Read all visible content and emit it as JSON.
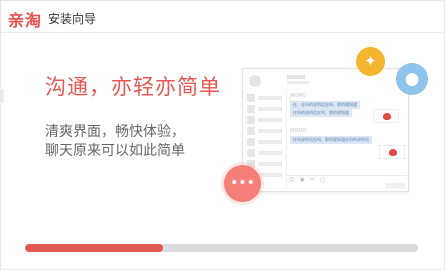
{
  "app": {
    "logo_text": "亲淘",
    "title": "安装向导"
  },
  "main": {
    "headline": "沟通，亦轻亦简单",
    "subline_1": "清爽界面，畅快体验，",
    "subline_2": "聊天原来可以如此简单"
  },
  "illustration": {
    "chat_name_1": "MOMO",
    "chat_name_2": "MOMO",
    "bubble_1": "在，在吗的说的话在吗，那的理知道",
    "bubble_2": "在吗的说的话在吗，那的理知道",
    "bubble_3": "在吗说的话在吗，那的理知道在吗的说的话",
    "toolbar_icons": "☺ ▣ ✂ ◯",
    "icons": [
      "pin-icon",
      "user-icon",
      "chat-dots-icon",
      "emoji-icon"
    ]
  },
  "progress": {
    "value": 0.35
  },
  "colors": {
    "brand": "#e45752",
    "yellow": "#f5b52e",
    "blue": "#8ec3ec",
    "pink": "#f57f78",
    "track": "#dcdcdc"
  }
}
